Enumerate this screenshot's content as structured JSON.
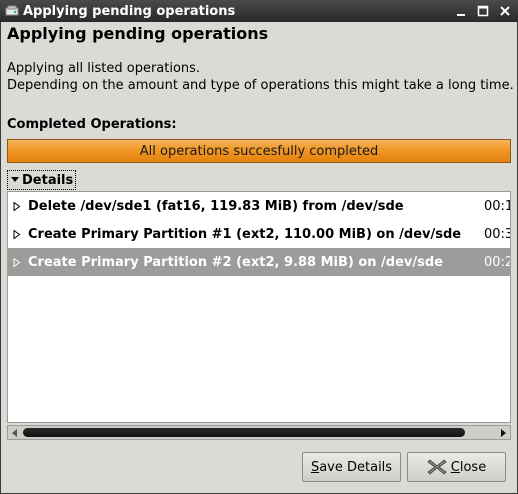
{
  "window": {
    "title": "Applying pending operations"
  },
  "dialog": {
    "heading": "Applying pending operations",
    "description_line1": "Applying all listed operations.",
    "description_line2": "Depending on the amount and type of operations this might take a long time.",
    "completed_label": "Completed Operations:",
    "progress": {
      "text": "All operations succesfully completed",
      "fraction": 1.0,
      "color": "#f19a2a"
    },
    "details_label": "Details",
    "operations": [
      {
        "text": "Delete /dev/sde1 (fat16, 119.83 MiB) from /dev/sde",
        "time": "00:1",
        "selected": false
      },
      {
        "text": "Create Primary Partition #1 (ext2, 110.00 MiB) on /dev/sde",
        "time": "00:3",
        "selected": false
      },
      {
        "text": "Create Primary Partition #2 (ext2, 9.88 MiB) on /dev/sde",
        "time": "00:2",
        "selected": true
      }
    ],
    "buttons": {
      "save_mnemonic": "S",
      "save_rest": "ave Details",
      "close_mnemonic": "C",
      "close_rest": "lose"
    }
  },
  "icons": {
    "app": "disk-icon",
    "minimize": "minimize-icon",
    "maximize": "maximize-icon",
    "close": "close-icon",
    "expander": "triangle-down-icon",
    "row_expander": "triangle-right-icon",
    "close_button": "x-icon"
  }
}
